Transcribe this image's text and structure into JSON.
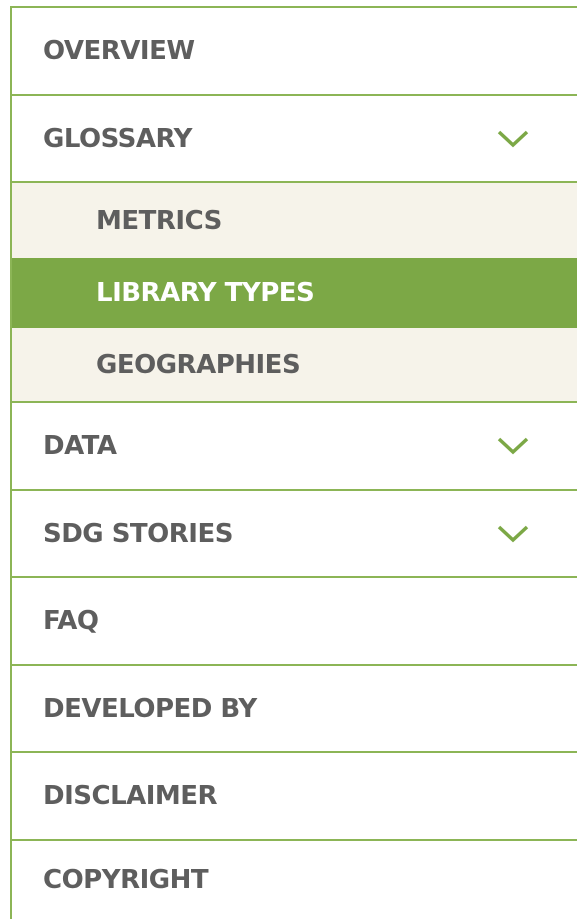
{
  "menu": {
    "overview": "OVERVIEW",
    "glossary": {
      "label": "GLOSSARY",
      "icon": "chevron-down-icon",
      "items": [
        "METRICS",
        "LIBRARY TYPES",
        "GEOGRAPHIES"
      ],
      "active_item": "LIBRARY TYPES"
    },
    "data": {
      "label": "DATA",
      "icon": "chevron-down-icon"
    },
    "sdg_stories": {
      "label": "SDG STORIES",
      "icon": "chevron-down-icon"
    },
    "faq": "FAQ",
    "developed_by": "DEVELOPED BY",
    "disclaimer": "DISCLAIMER",
    "copyright": "COPYRIGHT"
  },
  "colors": {
    "accent": "#7ca846",
    "border": "#8cb556",
    "submenu_background": "#f6f3ea",
    "text": "#5e5e5e",
    "active_text": "#ffffff"
  }
}
